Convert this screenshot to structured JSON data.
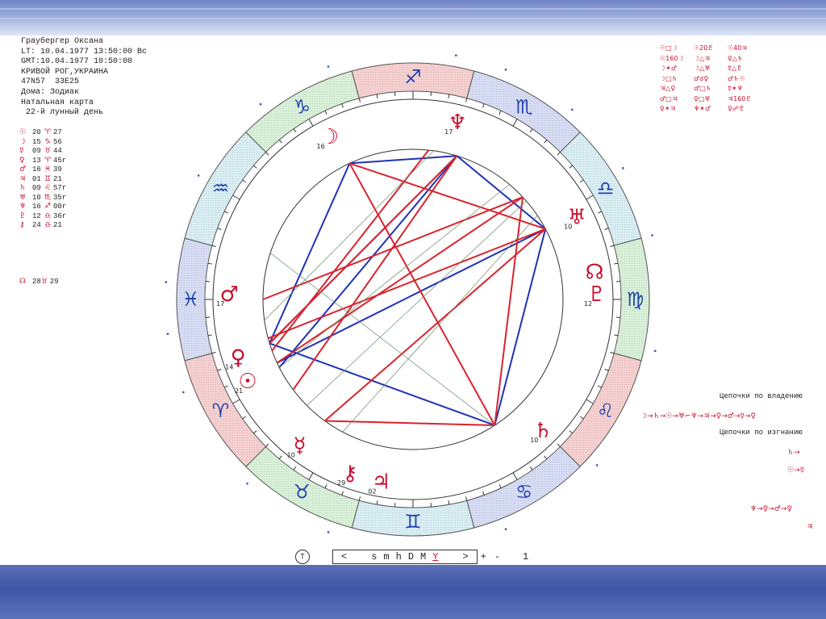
{
  "info": {
    "name": "Граубергер Оксана",
    "lt": "LT: 10.04.1977 13:50:00 Вс",
    "gmt": "GMT:10.04.1977 10:50:00",
    "place": "КРИВОЙ РОГ,УКРАИНА",
    "coords": "47N57  33E25",
    "houses": "Дома: Зодиак",
    "chart_type": "Натальная карта",
    "lunar_day": " 22-й лунный день"
  },
  "planets": [
    {
      "glyph": "☉",
      "deg": "20",
      "sign": "♈",
      "min": "27"
    },
    {
      "glyph": "☽",
      "deg": "15",
      "sign": "♑",
      "min": "56"
    },
    {
      "glyph": "☿",
      "deg": "09",
      "sign": "♉",
      "min": "44"
    },
    {
      "glyph": "♀",
      "deg": "13",
      "sign": "♈",
      "min": "45r"
    },
    {
      "glyph": "♂",
      "deg": "16",
      "sign": "♓",
      "min": "39"
    },
    {
      "glyph": "♃",
      "deg": "01",
      "sign": "♊",
      "min": "21"
    },
    {
      "glyph": "♄",
      "deg": "09",
      "sign": "♌",
      "min": "57r"
    },
    {
      "glyph": "♅",
      "deg": "10",
      "sign": "♏",
      "min": "35r"
    },
    {
      "glyph": "♆",
      "deg": "16",
      "sign": "♐",
      "min": "00r"
    },
    {
      "glyph": "♇",
      "deg": "12",
      "sign": "♎",
      "min": "36r"
    },
    {
      "glyph": "⚷",
      "deg": "24",
      "sign": "♎",
      "min": "21"
    }
  ],
  "extra_point": {
    "glyph": "☊",
    "deg": "28",
    "sign": "♉",
    "min": "29"
  },
  "aspect_table": [
    "☉□☽",
    "☉20♇",
    "☉40♃",
    "☉160☽",
    "☽△♃",
    "♀△♄",
    "☽✶♂",
    "☽△♅",
    "☿△♇",
    "☽□♄",
    "♂☌♀",
    "♂♄☉",
    "♃△♀",
    "♂□♄",
    "☿✶♆",
    "♂□♃",
    "♀□♅",
    "♃160♇",
    "♀✶♃",
    "♆✶♂",
    "♀☍♇"
  ],
  "chains": {
    "rule_label": "Цепочки по владению",
    "exile_label": "Цепочки по изгнанию",
    "rule_chain": "☽→♄→☉→♅⌐♆→♃→♀→♂→☿→♀",
    "exile_chain_a": "♄→",
    "exile_chain_b": "☉→☿",
    "exile_chain_c": "♆→♀→♂→♀",
    "exile_chain_d": "♃"
  },
  "toolbar": {
    "circle_btn": "T",
    "left": "<",
    "s": "s",
    "m": "m",
    "h": "h",
    "D": "D",
    "M": "M",
    "Y": "Y",
    "right": ">",
    "plus": "+",
    "minus": "-",
    "step": "1"
  },
  "wheel": {
    "signs": [
      {
        "glyph": "♑",
        "start": 315,
        "color": "#d8f0d8"
      },
      {
        "glyph": "♐",
        "start": 345,
        "color": "#f6d0d0"
      },
      {
        "glyph": "♏",
        "start": 15,
        "color": "#d6dcf3"
      },
      {
        "glyph": "♎",
        "start": 45,
        "color": "#d8eef3"
      },
      {
        "glyph": "♍",
        "start": 75,
        "color": "#d8f0d8"
      },
      {
        "glyph": "♌",
        "start": 105,
        "color": "#f6d0d0"
      },
      {
        "glyph": "♋",
        "start": 135,
        "color": "#d6dcf3"
      },
      {
        "glyph": "♊",
        "start": 165,
        "color": "#d8eef3"
      },
      {
        "glyph": "♉",
        "start": 195,
        "color": "#d8f0d8"
      },
      {
        "glyph": "♈",
        "start": 225,
        "color": "#f6d0d0"
      },
      {
        "glyph": "♓",
        "start": 255,
        "color": "#d6dcf3"
      },
      {
        "glyph": "♒",
        "start": 285,
        "color": "#d8eef3"
      }
    ],
    "planet_marks": [
      {
        "glyph": "☽",
        "num": "16",
        "ang": 333
      },
      {
        "glyph": "♆",
        "num": "17",
        "ang": 14
      },
      {
        "glyph": "♅",
        "num": "10",
        "ang": 63
      },
      {
        "glyph": "☊",
        "num": "",
        "ang": 81
      },
      {
        "glyph": "♇",
        "num": "12",
        "ang": 88
      },
      {
        "glyph": "♄",
        "num": "10",
        "ang": 135
      },
      {
        "glyph": "♂",
        "num": "17",
        "ang": 272
      },
      {
        "glyph": "♀",
        "num": "14",
        "ang": 252
      },
      {
        "glyph": "☉",
        "num": "21",
        "ang": 244
      },
      {
        "glyph": "☿",
        "num": "10",
        "ang": 218
      },
      {
        "glyph": "⚷",
        "num": "29",
        "ang": 200
      },
      {
        "glyph": "♃",
        "num": "02",
        "ang": 190
      }
    ]
  },
  "colors": {
    "red": "#d9232d",
    "blue": "#1f33b5",
    "glyph": "#c8102e"
  }
}
